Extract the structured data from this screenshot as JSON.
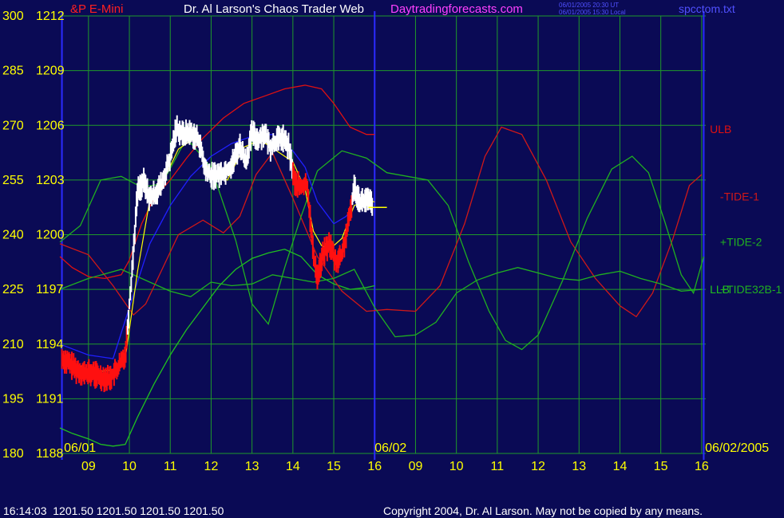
{
  "header": {
    "symbol": "&P E-Mini",
    "title": "Dr. Al Larson's Chaos Trader Web",
    "site": "Daytradingforecasts.com",
    "stamp_ut": "06/01/2005 20:30 UT",
    "stamp_local": "06/01/2005 15:30 Local",
    "filename": "spcctom.txt"
  },
  "footer": {
    "quote": "16:14:03  1201.50 1201.50 1201.50 1201.50",
    "copyright": "Copyright 2004, Dr. Al Larson. May not be copied by any means."
  },
  "colors": {
    "background": "#0a0a55",
    "grid": "#1f9a2a",
    "axis_text": "#ffff00",
    "day_divider": "#2a2aff",
    "price_up": "#ffffff",
    "price_down": "#ff1010",
    "ulb": "#e01010",
    "llb": "#20c020",
    "tide1": "#d01818",
    "tide2": "#20b020",
    "tide32b": "#20b020",
    "average": "#2020ff",
    "smooth": "#ffff00",
    "site": "#ff40ff",
    "stamp": "#5050ff"
  },
  "chart_data": {
    "type": "line",
    "y_ticks_left": [
      300,
      285,
      270,
      255,
      240,
      225,
      210,
      195,
      180
    ],
    "y_ticks_right": [
      "1212",
      "1209",
      "1206",
      "1203",
      "1200",
      "1197",
      "1194",
      "1191",
      "1188"
    ],
    "ylim": [
      1188,
      1212
    ],
    "xlim": [
      8.3,
      24.1
    ],
    "x_ticks": [
      {
        "x": 9,
        "label": "09"
      },
      {
        "x": 10,
        "label": "10"
      },
      {
        "x": 11,
        "label": "11"
      },
      {
        "x": 12,
        "label": "12"
      },
      {
        "x": 13,
        "label": "13"
      },
      {
        "x": 14,
        "label": "14"
      },
      {
        "x": 15,
        "label": "15"
      },
      {
        "x": 16,
        "label": "16"
      },
      {
        "x": 17,
        "label": "09"
      },
      {
        "x": 18,
        "label": "10"
      },
      {
        "x": 19,
        "label": "11"
      },
      {
        "x": 20,
        "label": "12"
      },
      {
        "x": 21,
        "label": "13"
      },
      {
        "x": 22,
        "label": "14"
      },
      {
        "x": 23,
        "label": "15"
      },
      {
        "x": 24,
        "label": "16"
      }
    ],
    "date_labels": [
      {
        "x": 8.4,
        "label": "06/01"
      },
      {
        "x": 16.0,
        "label": "06/02"
      },
      {
        "x": 24.2,
        "label": "06/02/2005"
      }
    ],
    "day_dividers": [
      8.35,
      16.0,
      24.05
    ],
    "grid": true,
    "series": [
      {
        "name": "ULB",
        "color": "ulb",
        "label_at": [
          24.2,
          1205.8
        ],
        "x": [
          8.3,
          8.6,
          9.0,
          9.4,
          9.8,
          10.0,
          10.3,
          10.6,
          11.0,
          11.4,
          11.8,
          12.3,
          12.8,
          13.3,
          13.8,
          14.3,
          14.7,
          15.0,
          15.4,
          15.8,
          16.0
        ],
        "y": [
          1198.8,
          1198.2,
          1197.7,
          1197.6,
          1197.8,
          1198.6,
          1200.6,
          1202.0,
          1203.0,
          1204.2,
          1205.3,
          1206.4,
          1207.2,
          1207.6,
          1208.0,
          1208.2,
          1208.0,
          1207.2,
          1205.9,
          1205.5,
          1205.5
        ]
      },
      {
        "name": "LLB",
        "color": "llb",
        "label_at": [
          24.2,
          1197.0
        ],
        "x": [
          8.3,
          8.6,
          9.0,
          9.3,
          9.6,
          9.9,
          10.2,
          10.6,
          11.0,
          11.4,
          11.8,
          12.2,
          12.6,
          13.0,
          13.4,
          13.8,
          14.2,
          14.6,
          15.0,
          15.4,
          15.8,
          16.0
        ],
        "y": [
          1189.4,
          1189.1,
          1188.8,
          1188.5,
          1188.4,
          1188.5,
          1190.0,
          1191.8,
          1193.4,
          1194.8,
          1196.0,
          1197.2,
          1198.1,
          1198.7,
          1199.0,
          1199.2,
          1198.8,
          1197.8,
          1197.3,
          1197.0,
          1197.1,
          1197.2
        ]
      },
      {
        "name": "-TIDE-1",
        "color": "tide1",
        "label_at": [
          24.45,
          1202.1
        ],
        "x": [
          8.3,
          9.0,
          9.6,
          10.1,
          10.4,
          10.8,
          11.2,
          11.8,
          12.3,
          12.7,
          13.1,
          13.5,
          14.0,
          14.6,
          15.2,
          15.8,
          16.3,
          17.0,
          17.6,
          18.2,
          18.7,
          19.1,
          19.6,
          20.2,
          20.8,
          21.4,
          22.0,
          22.4,
          22.8,
          23.3,
          23.7,
          24.0
        ],
        "y": [
          1199.5,
          1198.9,
          1197.2,
          1195.6,
          1196.2,
          1198.1,
          1200.0,
          1200.8,
          1200.1,
          1201.0,
          1203.3,
          1204.5,
          1202.0,
          1198.8,
          1196.9,
          1195.8,
          1195.9,
          1195.8,
          1197.2,
          1200.6,
          1204.3,
          1205.9,
          1205.5,
          1203.0,
          1199.6,
          1197.6,
          1196.1,
          1195.5,
          1196.8,
          1199.8,
          1202.7,
          1203.3
        ]
      },
      {
        "name": "+TIDE-2",
        "color": "tide2",
        "label_at": [
          24.45,
          1199.6
        ],
        "x": [
          8.3,
          8.8,
          9.3,
          9.8,
          10.3,
          10.8,
          11.4,
          12.0,
          12.6,
          13.0,
          13.4,
          13.8,
          14.2,
          14.6,
          15.2,
          15.8,
          16.3,
          16.8,
          17.3,
          17.8,
          18.3,
          18.8,
          19.2,
          19.6,
          20.0,
          20.6,
          21.2,
          21.8,
          22.3,
          22.7,
          23.1,
          23.5,
          23.8,
          24.05
        ],
        "y": [
          1199.6,
          1200.5,
          1203.0,
          1203.2,
          1202.6,
          1202.8,
          1205.3,
          1203.7,
          1199.7,
          1196.2,
          1195.1,
          1198.2,
          1201.0,
          1203.5,
          1204.6,
          1204.2,
          1203.4,
          1203.2,
          1203.0,
          1201.6,
          1198.5,
          1195.8,
          1194.2,
          1193.7,
          1194.5,
          1197.5,
          1200.9,
          1203.6,
          1204.3,
          1203.4,
          1200.7,
          1197.8,
          1196.8,
          1198.8
        ]
      },
      {
        "name": "+TIDE32B-1",
        "color": "tide32b",
        "label_at": [
          24.45,
          1197.0
        ],
        "x": [
          8.3,
          9.0,
          9.8,
          10.5,
          11.0,
          11.5,
          12.0,
          12.5,
          13.0,
          13.5,
          14.0,
          14.5,
          15.0,
          15.5,
          16.0,
          16.5,
          17.0,
          17.5,
          18.0,
          18.5,
          19.0,
          19.5,
          20.0,
          20.5,
          21.0,
          21.5,
          22.0,
          22.5,
          23.0,
          23.5,
          24.0
        ],
        "y": [
          1197.0,
          1197.6,
          1198.1,
          1197.4,
          1196.9,
          1196.6,
          1197.4,
          1197.2,
          1197.3,
          1197.8,
          1197.6,
          1197.4,
          1197.6,
          1198.1,
          1196.0,
          1194.4,
          1194.5,
          1195.2,
          1196.8,
          1197.5,
          1197.9,
          1198.2,
          1197.9,
          1197.6,
          1197.5,
          1197.8,
          1198.0,
          1197.6,
          1197.3,
          1196.9,
          1197.0
        ]
      },
      {
        "name": "",
        "color": "average",
        "x": [
          8.3,
          9.0,
          9.6,
          10.0,
          10.5,
          11.0,
          11.5,
          12.0,
          12.5,
          13.0,
          13.5,
          14.0,
          14.3,
          14.6,
          15.0,
          15.3,
          15.6,
          15.9
        ],
        "y": [
          1194.0,
          1193.4,
          1193.2,
          1196.0,
          1199.5,
          1201.6,
          1203.2,
          1204.3,
          1205.0,
          1205.4,
          1205.5,
          1204.6,
          1203.7,
          1201.8,
          1200.6,
          1201.0,
          1201.8,
          1202.0
        ]
      },
      {
        "name": "",
        "color": "smooth",
        "x": [
          8.35,
          8.7,
          9.0,
          9.3,
          9.6,
          9.9,
          10.2,
          10.5,
          10.9,
          11.2,
          11.6,
          12.0,
          12.4,
          12.8,
          13.2,
          13.6,
          14.0,
          14.3,
          14.5,
          14.7,
          14.9,
          15.2,
          15.5,
          15.8,
          16.0
        ],
        "y": [
          1193.3,
          1192.9,
          1192.6,
          1192.5,
          1192.6,
          1193.2,
          1198.0,
          1201.9,
          1203.3,
          1204.7,
          1205.3,
          1203.3,
          1203.0,
          1204.8,
          1205.2,
          1204.6,
          1204.0,
          1202.5,
          1200.2,
          1199.4,
          1199.2,
          1199.8,
          1201.6,
          1201.9,
          1201.8
        ]
      }
    ],
    "price_trace": {
      "x": [
        8.35,
        8.5,
        8.7,
        8.9,
        9.1,
        9.3,
        9.5,
        9.7,
        9.8,
        9.9,
        10.05,
        10.2,
        10.35,
        10.5,
        10.65,
        10.8,
        11.0,
        11.15,
        11.3,
        11.5,
        11.7,
        11.85,
        12.0,
        12.15,
        12.3,
        12.5,
        12.7,
        12.85,
        13.0,
        13.15,
        13.3,
        13.45,
        13.6,
        13.75,
        13.9,
        14.05,
        14.2,
        14.35,
        14.5,
        14.6,
        14.75,
        14.9,
        15.05,
        15.2,
        15.35,
        15.5,
        15.65,
        15.8,
        15.95
      ],
      "y": [
        1193.2,
        1193.0,
        1192.6,
        1192.4,
        1192.4,
        1192.2,
        1192.1,
        1192.6,
        1193.0,
        1193.4,
        1197.6,
        1202.4,
        1202.9,
        1202.0,
        1202.3,
        1202.8,
        1204.2,
        1205.9,
        1205.5,
        1205.6,
        1205.2,
        1203.6,
        1203.2,
        1203.3,
        1203.4,
        1203.8,
        1204.9,
        1204.0,
        1205.6,
        1205.2,
        1205.6,
        1204.8,
        1205.2,
        1205.3,
        1204.8,
        1202.8,
        1202.6,
        1202.8,
        1198.9,
        1197.7,
        1199.0,
        1199.5,
        1198.5,
        1198.9,
        1200.5,
        1202.6,
        1201.8,
        1201.9,
        1201.7
      ],
      "decline_ranges": [
        [
          8.35,
          9.95
        ],
        [
          14.0,
          15.45
        ]
      ],
      "last_price_line": {
        "x": [
          15.85,
          16.3
        ],
        "y": 1201.5
      }
    }
  }
}
